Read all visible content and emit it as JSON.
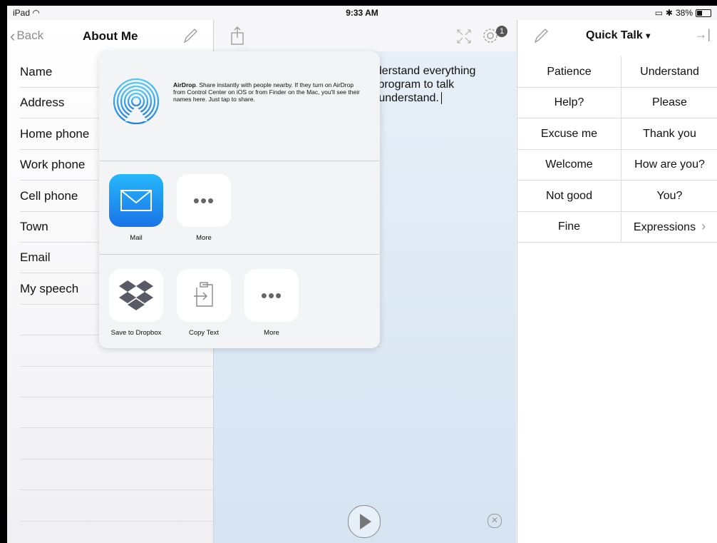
{
  "status": {
    "device": "iPad",
    "time": "9:33 AM",
    "battery": "38%"
  },
  "left": {
    "back_label": "Back",
    "title": "About Me",
    "rows": [
      "Name",
      "Address",
      "Home phone",
      "Work phone",
      "Cell phone",
      "Town",
      "Email",
      "My speech"
    ]
  },
  "middle": {
    "text_lines": [
      "nderstand everything",
      "s program to talk",
      "o understand."
    ],
    "badge_count": "1"
  },
  "share": {
    "airdrop_title": "AirDrop",
    "airdrop_desc": ". Share instantly with people nearby. If they turn on AirDrop from Control Center on iOS or from Finder on the Mac, you'll see their names here. Just tap to share.",
    "apps": [
      {
        "label": "Mail",
        "icon": "mail-icon"
      },
      {
        "label": "More",
        "icon": "more-icon"
      }
    ],
    "actions": [
      {
        "label": "Save to Dropbox",
        "icon": "dropbox-icon"
      },
      {
        "label": "Copy Text",
        "icon": "copy-text-icon"
      },
      {
        "label": "More",
        "icon": "more-icon"
      }
    ]
  },
  "right": {
    "title": "Quick Talk",
    "title_caret": "▾",
    "cells": [
      [
        "Patience",
        "Understand"
      ],
      [
        "Help?",
        "Please"
      ],
      [
        "Excuse me",
        "Thank you"
      ],
      [
        "Welcome",
        "How are you?"
      ],
      [
        "Not good",
        "You?"
      ],
      [
        "Fine",
        "Expressions"
      ]
    ]
  },
  "colors": {
    "mail_blue": "#1e8ef0",
    "accent_gray": "#8e8e93"
  }
}
